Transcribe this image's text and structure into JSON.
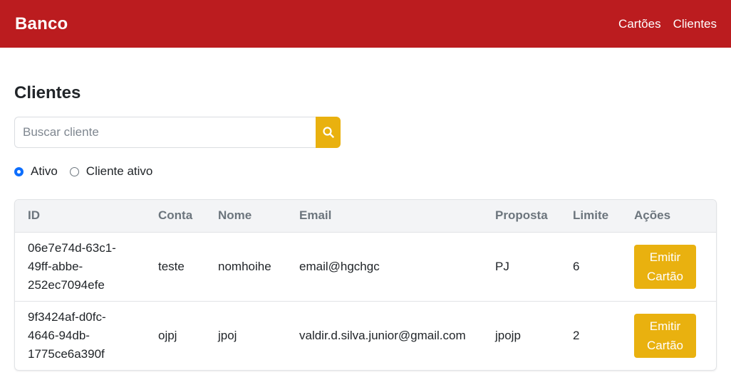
{
  "navbar": {
    "brand": "Banco",
    "links": [
      "Cartões",
      "Clientes"
    ]
  },
  "page": {
    "title": "Clientes"
  },
  "search": {
    "placeholder": "Buscar cliente",
    "value": "",
    "button_icon": "search-icon"
  },
  "filters": [
    {
      "label": "Ativo",
      "checked": true
    },
    {
      "label": "Cliente ativo",
      "checked": false
    }
  ],
  "table": {
    "headers": [
      "ID",
      "Conta",
      "Nome",
      "Email",
      "Proposta",
      "Limite",
      "Ações"
    ],
    "rows": [
      {
        "id": "06e7e74d-63c1-49ff-abbe-252ec7094efe",
        "id_lines": [
          "06e7e74d-63c1-",
          "49ff-abbe-",
          "252ec7094efe"
        ],
        "conta": "teste",
        "nome": "nomhoihe",
        "email": "email@hgchgc",
        "proposta": "PJ",
        "limite": "6",
        "action_label": "Emitir Cartão",
        "action_lines": [
          "Emitir",
          "Cartão"
        ]
      },
      {
        "id": "9f3424af-d0fc-4646-94db-1775ce6a390f",
        "id_lines": [
          "9f3424af-d0fc-",
          "4646-94db-",
          "1775ce6a390f"
        ],
        "conta": "ojpj",
        "nome": "jpoj",
        "email": "valdir.d.silva.junior@gmail.com",
        "proposta": "jpojp",
        "limite": "2",
        "action_label": "Emitir Cartão",
        "action_lines": [
          "Emitir",
          "Cartão"
        ]
      }
    ]
  },
  "colors": {
    "navbar": "#bb1c1f",
    "accent": "#e9b10f",
    "radio_checked": "#0d6efd"
  }
}
